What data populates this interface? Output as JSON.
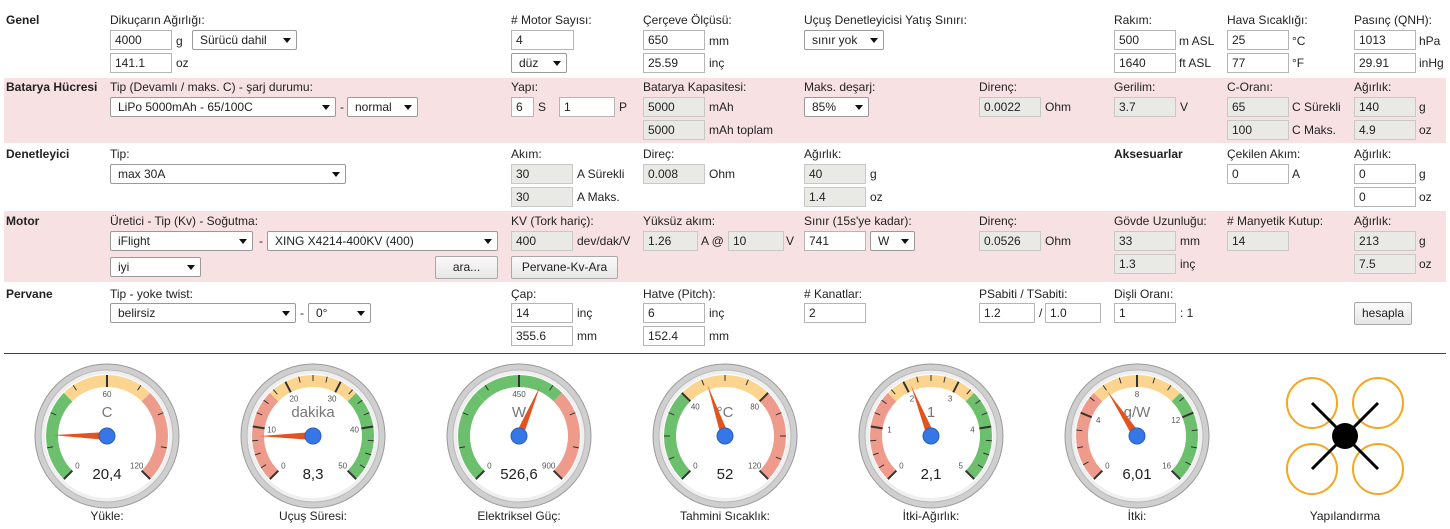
{
  "general": {
    "title": "Genel",
    "weight_label": "Dikuçarın Ağırlığı:",
    "weight_g": "4000",
    "unit_g": "g",
    "weight_mode": "Sürücü dahil",
    "weight_oz": "141.1",
    "unit_oz": "oz",
    "motor_count_label": "# Motor Sayısı:",
    "motor_count": "4",
    "frame_type": "düz",
    "frame_size_label": "Çerçeve Ölçüsü:",
    "frame_mm": "650",
    "unit_mm": "mm",
    "frame_in": "25.59",
    "unit_inch": "inç",
    "tilt_label": "Uçuş Denetleyicisi Yatış Sınırı:",
    "tilt_value": "sınır yok",
    "elevation_label": "Rakım:",
    "elevation_m": "500",
    "unit_m_asl": "m ASL",
    "elevation_ft": "1640",
    "unit_ft_asl": "ft ASL",
    "temp_label": "Hava Sıcaklığı:",
    "temp_c": "25",
    "unit_c": "°C",
    "temp_f": "77",
    "unit_f": "°F",
    "pressure_label": "Pasınç (QNH):",
    "pressure_hpa": "1013",
    "unit_hpa": "hPa",
    "pressure_inhg": "29.91",
    "unit_inhg": "inHg"
  },
  "battery": {
    "title": "Batarya Hücresi",
    "type_label": "Tip (Devamlı / maks. C) - şarj durumu:",
    "type_value": "LiPo 5000mAh - 65/100C",
    "dash": "-",
    "charge_state": "normal",
    "config_label": "Yapı:",
    "s_value": "6",
    "s_unit": "S",
    "p_value": "1",
    "p_unit": "P",
    "capacity_label": "Batarya Kapasitesi:",
    "capacity": "5000",
    "capacity_unit": "mAh",
    "capacity_total": "5000",
    "capacity_total_unit": "mAh toplam",
    "discharge_label": "Maks. deşarj:",
    "discharge": "85%",
    "resistance_label": "Direnç:",
    "resistance": "0.0022",
    "unit_ohm": "Ohm",
    "voltage_label": "Gerilim:",
    "voltage": "3.7",
    "unit_v": "V",
    "c_rate_label": "C-Oranı:",
    "c_cont": "65",
    "c_cont_unit": "C Sürekli",
    "c_max": "100",
    "c_max_unit": "C Maks.",
    "weight_label": "Ağırlık:",
    "weight_g": "140",
    "weight_oz": "4.9",
    "unit_g": "g",
    "unit_oz": "oz"
  },
  "controller": {
    "title": "Denetleyici",
    "type_label": "Tip:",
    "type_value": "max 30A",
    "current_label": "Akım:",
    "current_cont": "30",
    "current_cont_unit": "A Sürekli",
    "current_max": "30",
    "current_max_unit": "A Maks.",
    "resistance_label": "Direç:",
    "resistance": "0.008",
    "unit_ohm": "Ohm",
    "weight_label": "Ağırlık:",
    "weight_g": "40",
    "weight_oz": "1.4",
    "unit_g": "g",
    "unit_oz": "oz",
    "accessories_title": "Aksesuarlar",
    "acc_current_label": "Çekilen Akım:",
    "acc_current": "0",
    "unit_a": "A",
    "acc_weight_label": "Ağırlık:",
    "acc_weight_g": "0",
    "acc_weight_oz": "0"
  },
  "motor": {
    "title": "Motor",
    "type_label": "Üretici - Tip (Kv) - Soğutma:",
    "manufacturer": "iFlight",
    "dash": "-",
    "model": "XING X4214-400KV (400)",
    "cooling": "iyi",
    "search_btn": "ara...",
    "kv_label": "KV (Tork hariç):",
    "kv": "400",
    "kv_unit": "dev/dak/V",
    "pervane_btn": "Pervane-Kv-Ara",
    "no_load_label": "Yüksüz akım:",
    "no_load_a": "1.26",
    "no_load_at": "A @",
    "no_load_v": "10",
    "unit_v": "V",
    "limit_label": "Sınır (15s'ye kadar):",
    "limit_value": "741",
    "limit_unit": "W",
    "resistance_label": "Direnç:",
    "resistance": "0.0526",
    "unit_ohm": "Ohm",
    "case_len_label": "Gövde Uzunluğu:",
    "case_len_mm": "33",
    "case_len_in": "1.3",
    "unit_mm": "mm",
    "unit_in": "inç",
    "poles_label": "# Manyetik Kutup:",
    "poles": "14",
    "weight_label": "Ağırlık:",
    "weight_g": "213",
    "weight_oz": "7.5",
    "unit_g": "g",
    "unit_oz": "oz"
  },
  "propeller": {
    "title": "Pervane",
    "type_label": "Tip - yoke twist:",
    "type_value": "belirsiz",
    "dash": "-",
    "twist": "0°",
    "diameter_label": "Çap:",
    "diameter_in": "14",
    "diameter_mm": "355.6",
    "unit_in": "inç",
    "unit_mm": "mm",
    "pitch_label": "Hatve (Pitch):",
    "pitch_in": "6",
    "pitch_mm": "152.4",
    "blades_label": "# Kanatlar:",
    "blades": "2",
    "pconst_label": "PSabiti / TSabiti:",
    "pconst": "1.2",
    "slash": "/",
    "tconst": "1.0",
    "gear_label": "Dişli Oranı:",
    "gear": "1",
    "gear_suffix": ": 1",
    "calc_btn": "hesapla"
  },
  "gauges": [
    {
      "caption": "Yükle:",
      "center_label": "C",
      "value": "20,4",
      "ticks": [
        "0",
        "60",
        "120"
      ],
      "colors": [
        "#6cbf6c",
        "#fbd590",
        "#ee9b8c"
      ],
      "needle_level": 0.17
    },
    {
      "caption": "Uçuş Süresi:",
      "center_label": "dakika",
      "value": "8,3",
      "ticks": [
        "0",
        "10",
        "20",
        "30",
        "40",
        "50"
      ],
      "colors": [
        "#ee9b8c",
        "#fbd590",
        "#6cbf6c"
      ],
      "needle_level": 0.166
    },
    {
      "caption": "Elektriksel Güç:",
      "center_label": "W",
      "value": "526,6",
      "ticks": [
        "0",
        "450",
        "900"
      ],
      "colors": [
        "#6cbf6c",
        "#6cbf6c",
        "#ee9b8c"
      ],
      "needle_level": 0.585
    },
    {
      "caption": "Tahmini Sıcaklık:",
      "center_label": "°C",
      "value": "52",
      "ticks": [
        "0",
        "40",
        "80",
        "120"
      ],
      "colors": [
        "#6cbf6c",
        "#fbd590",
        "#ee9b8c"
      ],
      "needle_level": 0.43
    },
    {
      "caption": "İtki-Ağırlık:",
      "center_label": "1",
      "value": "2,1",
      "ticks": [
        "0",
        "1",
        "2",
        "3",
        "4",
        "5"
      ],
      "colors": [
        "#ee9b8c",
        "#fbd590",
        "#6cbf6c"
      ],
      "needle_level": 0.42
    },
    {
      "caption": "İtki:",
      "center_label": "g/W",
      "value": "6,01",
      "ticks": [
        "0",
        "4",
        "8",
        "12",
        "16"
      ],
      "colors": [
        "#ee9b8c",
        "#fbd590",
        "#6cbf6c"
      ],
      "needle_level": 0.376
    }
  ],
  "config": {
    "caption": "Yapılandırma"
  }
}
